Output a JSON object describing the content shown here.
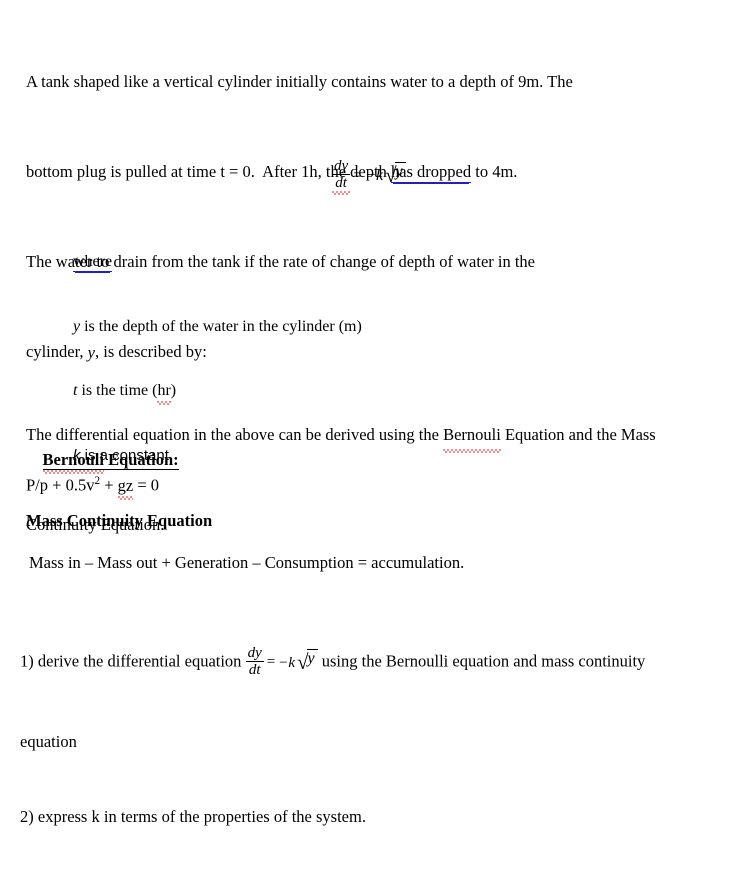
{
  "document": {
    "background_color": "#ffffff",
    "text_color": "#000000",
    "spellcheck_color": "#e01b1b",
    "hyperlink_underline_color": "#2222bb"
  },
  "intro": {
    "line1_a": "A tank shaped like a vertical cylinder initially contains water to a depth of 9m. The",
    "line2_a": "bottom plug is pulled at time t = 0.  After 1h, the depth ",
    "line2_underlined": "has dropped",
    "line2_b": " to 4m.",
    "line3": "The water to drain from the tank if the rate of change of depth of water in the",
    "line4_a": "cylinder, ",
    "line4_var": "y",
    "line4_b": ", is described by:"
  },
  "display_equation": {
    "numerator": "dy",
    "denominator": "dt",
    "equals": "=",
    "minus_k": "−k",
    "radical_symbol": "√",
    "radicand": "y",
    "denominator_has_spellcheck": true
  },
  "definitions": {
    "where_label": "where",
    "lines": [
      {
        "var": "y",
        "text": " is the depth of the water in the cylinder (m)",
        "style": "serif"
      },
      {
        "var": "t",
        "text_before": " is the time (",
        "squiggle_word": "hr",
        "text_after": ")",
        "style": "serif"
      },
      {
        "var": "k",
        "text": " is a constant",
        "style": "sans"
      }
    ]
  },
  "mid_paragraph": {
    "line1_a": "The differential equation in the above can be derived using the ",
    "line1_squiggle": "Bernouli",
    "line1_b": " Equation and the Mass",
    "line2": "Continuity Equation."
  },
  "bernouli_section": {
    "heading_squiggle": "Bernouli",
    "heading_rest": " Equation:",
    "equation_a": "P/p + 0.5v",
    "equation_sup": "2",
    "equation_b": " + ",
    "equation_squiggle": "gz",
    "equation_c": " = 0"
  },
  "mass_continuity_section": {
    "heading": "Mass Continuity Equation",
    "equation": "Mass in – Mass out + Generation – Consumption = accumulation."
  },
  "tasks": {
    "item1_a": "1) derive the differential equation ",
    "item1_b": " using the Bernoulli equation and mass continuity",
    "item1_c": "equation",
    "item2": "2) express k in terms of the properties of the system.",
    "inline_equation": {
      "numerator": "dy",
      "denominator": "dt",
      "equals": "=",
      "minus_k": "−k",
      "radical_symbol": "√",
      "radicand": "y"
    }
  }
}
